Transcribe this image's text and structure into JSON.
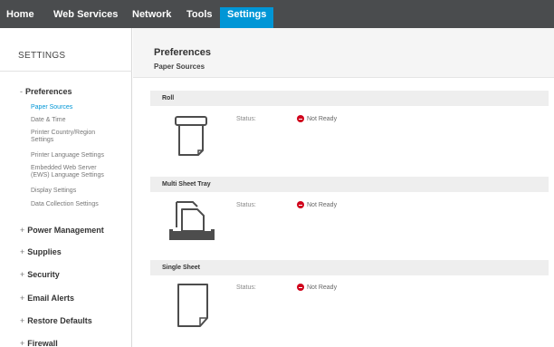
{
  "nav": {
    "tabs": [
      {
        "label": "Home"
      },
      {
        "label": "Web Services"
      },
      {
        "label": "Network"
      },
      {
        "label": "Tools"
      },
      {
        "label": "Settings",
        "active": true
      }
    ]
  },
  "sidebar": {
    "title": "SETTINGS",
    "preferences": {
      "sign": "-",
      "label": "Preferences",
      "items": [
        {
          "label": "Paper Sources",
          "active": true
        },
        {
          "label": "Date & Time"
        },
        {
          "label": "Printer Country/Region"
        },
        {
          "label": "Settings"
        },
        {
          "label": "Printer Language Settings"
        },
        {
          "label": "Embedded Web Server"
        },
        {
          "label": "(EWS) Language Settings"
        },
        {
          "label": "Display Settings"
        },
        {
          "label": "Data Collection Settings"
        }
      ]
    },
    "sections": [
      {
        "sign": "+",
        "label": "Power Management"
      },
      {
        "sign": "+",
        "label": "Supplies"
      },
      {
        "sign": "+",
        "label": "Security"
      },
      {
        "sign": "+",
        "label": "Email Alerts"
      },
      {
        "sign": "+",
        "label": "Restore Defaults"
      },
      {
        "sign": "+",
        "label": "Firewall"
      }
    ]
  },
  "main": {
    "title": "Preferences",
    "subtitle": "Paper Sources",
    "sources": [
      {
        "name": "Roll",
        "status_label": "Status:",
        "status": "Not Ready",
        "icon": "roll-paper-icon"
      },
      {
        "name": "Multi Sheet Tray",
        "status_label": "Status:",
        "status": "Not Ready",
        "icon": "multi-sheet-tray-icon"
      },
      {
        "name": "Single Sheet",
        "status_label": "Status:",
        "status": "Not Ready",
        "icon": "single-sheet-icon"
      }
    ]
  },
  "colors": {
    "topbar": "#4a4c4e",
    "active_tab": "#0096d6",
    "active_link": "#0096d6",
    "status_error": "#d0021b"
  }
}
